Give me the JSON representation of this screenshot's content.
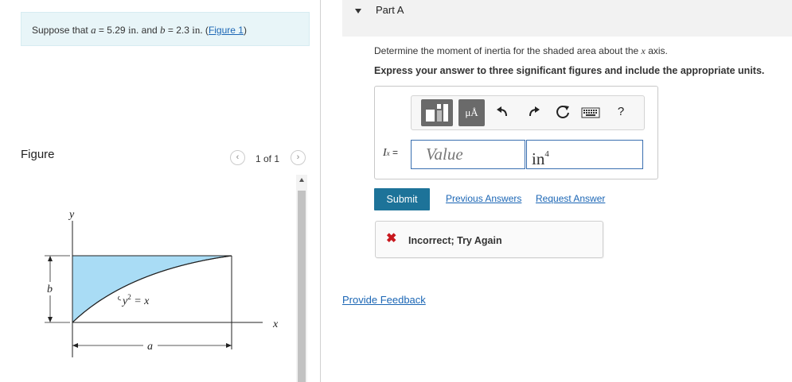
{
  "problem": {
    "intro": "Suppose that ",
    "a_var": "a",
    "eq1": " = 5.29 ",
    "a_unit": "in.",
    "and": " and ",
    "b_var": "b",
    "eq2": " = 2.3 ",
    "b_unit": "in.",
    "open_paren": " (",
    "figure_link": "Figure 1",
    "close_paren": ")"
  },
  "figure_panel": {
    "title": "Figure",
    "page_label": "1 of 1",
    "prev_icon": "chevron-left-icon",
    "next_icon": "chevron-right-icon",
    "labels": {
      "y_axis": "y",
      "x_axis": "x",
      "curve_eq_base": "y",
      "curve_eq_exp": "2",
      "curve_eq_rhs": " = x",
      "b_dim": "b",
      "a_dim": "a"
    },
    "colors": {
      "shaded_fill": "#a9dcf5",
      "line": "#222222"
    }
  },
  "part": {
    "title": "Part A",
    "question_pre": "Determine the moment of inertia for the shaded area about the ",
    "question_var": "x",
    "question_post": " axis.",
    "instruction": "Express your answer to three significant figures and include the appropriate units."
  },
  "toolbar": {
    "templates_icon": "templates-icon",
    "units_label": "μÅ",
    "undo_icon": "undo-icon",
    "redo_icon": "redo-icon",
    "reset_icon": "reset-icon",
    "keyboard_icon": "keyboard-icon",
    "help_label": "?"
  },
  "answer": {
    "lhs_base": "I",
    "lhs_sub": "x",
    "lhs_eq": " =",
    "value_placeholder": "Value",
    "unit_base": "in",
    "unit_exp": "4"
  },
  "actions": {
    "submit_label": "Submit",
    "previous_answers": "Previous Answers",
    "request_answer": "Request Answer"
  },
  "feedback": {
    "icon": "✖",
    "text": "Incorrect; Try Again",
    "icon_color": "#c8181e"
  },
  "provide_feedback": "Provide Feedback"
}
